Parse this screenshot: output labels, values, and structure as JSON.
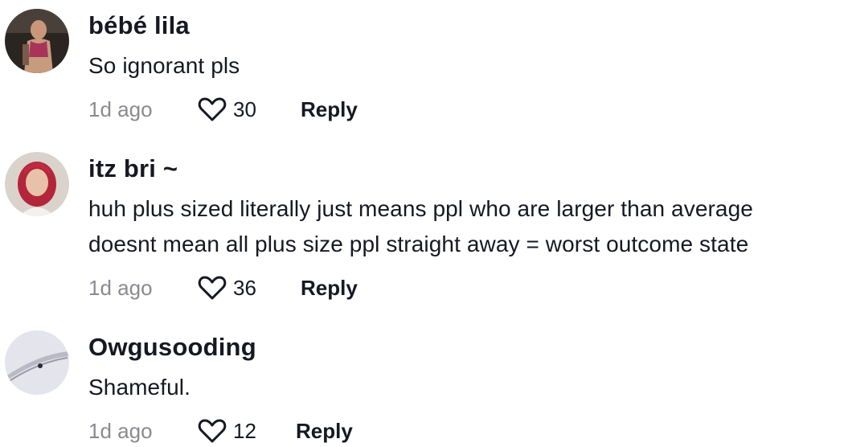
{
  "comments": [
    {
      "username": "bébé lila",
      "text_lines": [
        "So ignorant pls"
      ],
      "time": "1d ago",
      "likes": "30",
      "reply_label": "Reply"
    },
    {
      "username": "itz bri ~",
      "text_lines": [
        "huh plus sized literally just means ppl who are larger than average",
        "doesnt mean all plus size ppl straight away = worst outcome state"
      ],
      "time": "1d ago",
      "likes": "36",
      "reply_label": "Reply"
    },
    {
      "username": "Owgusooding",
      "text_lines": [
        "Shameful."
      ],
      "time": "1d ago",
      "likes": "12",
      "reply_label": "Reply"
    }
  ],
  "icons": {
    "like": "heart-outline-icon"
  },
  "colors": {
    "text": "#161823",
    "secondary": "#8a8b91",
    "background": "#ffffff"
  }
}
